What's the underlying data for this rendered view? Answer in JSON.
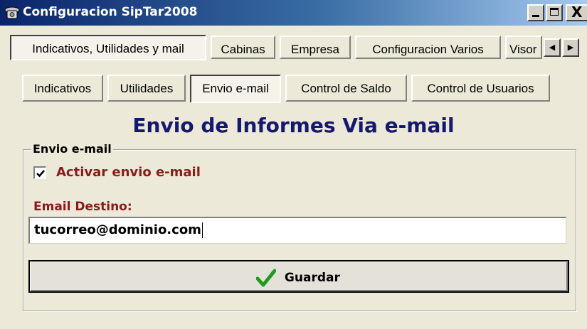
{
  "window": {
    "title": "Configuracion SipTar2008",
    "controls": {
      "minimize": "_",
      "close": "X"
    }
  },
  "main_tabs": [
    {
      "label": "Indicativos, Utilidades y mail",
      "selected": true
    },
    {
      "label": "Cabinas",
      "selected": false
    },
    {
      "label": "Empresa",
      "selected": false
    },
    {
      "label": "Configuracion Varios",
      "selected": false
    },
    {
      "label": "Visor",
      "selected": false
    }
  ],
  "tab_scroll": {
    "left_icon": "left-arrow-icon",
    "right_icon": "right-arrow-icon"
  },
  "sub_tabs": [
    {
      "label": "Indicativos",
      "selected": false
    },
    {
      "label": "Utilidades",
      "selected": false
    },
    {
      "label": "Envio e-mail",
      "selected": true
    },
    {
      "label": "Control de Saldo",
      "selected": false
    },
    {
      "label": "Control de Usuarios",
      "selected": false
    }
  ],
  "heading": "Envio de Informes Via e-mail",
  "group": {
    "legend": "Envio e-mail",
    "checkbox": {
      "label": "Activar envio e-mail",
      "checked": true
    },
    "email_label": "Email Destino:",
    "email_value": "tucorreo@dominio.com",
    "save_label": "Guardar",
    "save_icon": "checkmark-icon"
  },
  "colors": {
    "heading": "#14186e",
    "label": "#8b1a1a",
    "check_icon": "#1f9a1f",
    "titlebar_start": "#0a246a",
    "titlebar_end": "#a6caf0"
  }
}
